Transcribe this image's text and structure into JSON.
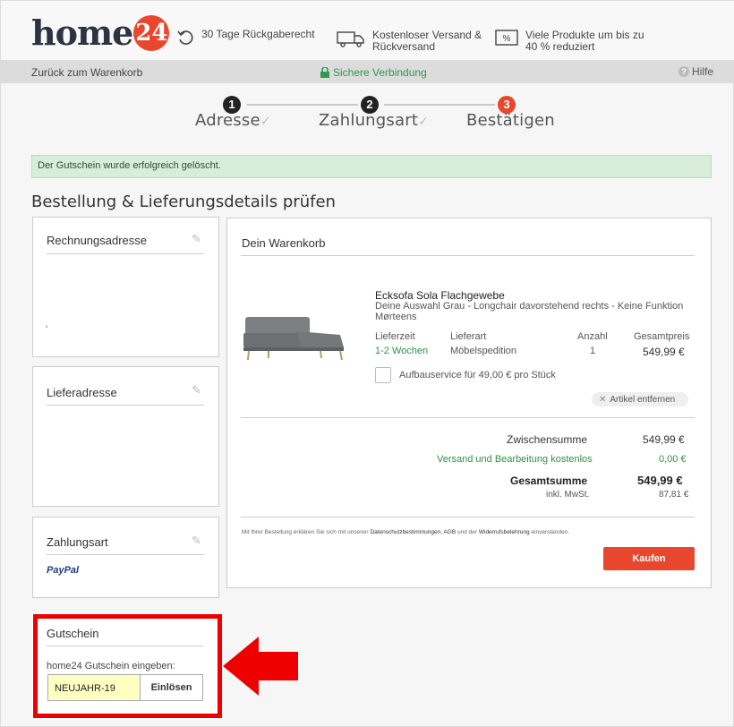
{
  "header": {
    "logo_text": "home24",
    "usps": [
      {
        "icon": "return-arrow-icon",
        "line1": "30 Tage Rückgaberecht",
        "line2": ""
      },
      {
        "icon": "truck-icon",
        "line1": "Kostenloser Versand &",
        "line2": "Rückversand"
      },
      {
        "icon": "percent-tag-icon",
        "line1": "Viele Produkte um bis zu",
        "line2": "40 % reduziert"
      }
    ]
  },
  "subbar": {
    "back_label": "Zurück zum Warenkorb",
    "secure_label": "Sichere Verbindung",
    "help_label": "Hilfe"
  },
  "steps": [
    {
      "number": "1",
      "label": "Adresse",
      "done": true
    },
    {
      "number": "2",
      "label": "Zahlungsart",
      "done": true
    },
    {
      "number": "3",
      "label": "Bestätigen",
      "done": false
    }
  ],
  "success_message": "Der Gutschein wurde erfolgreich gelöscht.",
  "section_title": "Bestellung & Lieferungsdetails prüfen",
  "billing": {
    "title": "Rechnungsadresse",
    "content": "'"
  },
  "shipping": {
    "title": "Lieferadresse"
  },
  "payment": {
    "title": "Zahlungsart",
    "method": "PayPal"
  },
  "voucher": {
    "title": "Gutschein",
    "label": "home24 Gutschein eingeben:",
    "value": "NEUJAHR-19",
    "button": "Einlösen"
  },
  "cart": {
    "title": "Dein Warenkorb",
    "item": {
      "name": "Ecksofa Sola Flachgewebe",
      "description": "Deine Auswahl Grau - Longchair davorstehend rechts - Keine Funktion",
      "brand": "Mørteens",
      "headers": {
        "delivery_time": "Lieferzeit",
        "delivery_type": "Lieferart",
        "quantity": "Anzahl",
        "total": "Gesamtpreis"
      },
      "delivery_time": "1-2 Wochen",
      "delivery_type": "Möbelspedition",
      "quantity": "1",
      "total": "549,99 €",
      "assembly_label": "Aufbauservice für 49,00 € pro Stück",
      "remove_label": "Artikel entfernen"
    },
    "summary": {
      "subtotal_label": "Zwischensumme",
      "subtotal": "549,99 €",
      "shipping_label": "Versand und Bearbeitung kostenlos",
      "shipping": "0,00 €",
      "total_label": "Gesamtsumme",
      "total": "549,99 €",
      "vat_label": "inkl. MwSt.",
      "vat": "87,81 €"
    },
    "legal_prefix": "Mit Ihrer Bestellung erklären Sie sich mit unseren ",
    "legal_links": "Datenschutzbestimmungen, AGB",
    "legal_middle": " und der ",
    "legal_link2": "Widerrufsbelehrung",
    "legal_suffix": " einverstanden.",
    "buy_label": "Kaufen"
  },
  "colors": {
    "accent": "#e8472e",
    "secure_green": "#2f9a4a",
    "success_bg": "#d9eed9",
    "highlight_red": "#e00000"
  }
}
